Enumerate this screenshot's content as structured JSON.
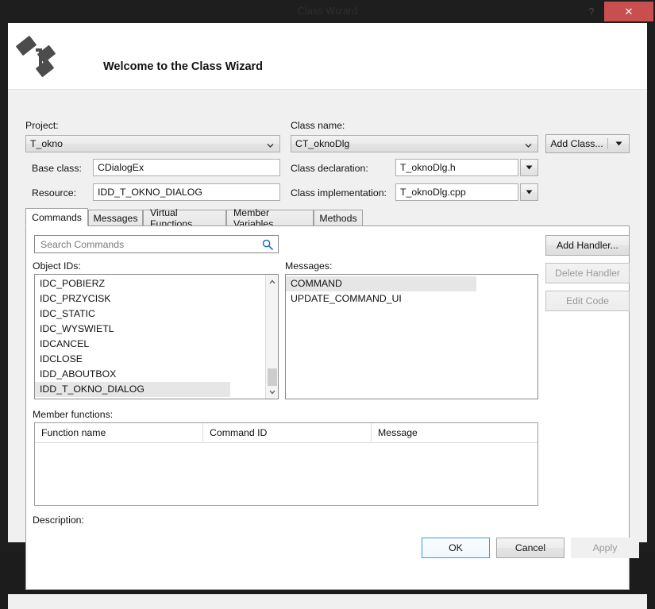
{
  "window": {
    "title": "Class Wizard",
    "help_icon": "question-mark-icon",
    "close_icon": "✕"
  },
  "header": {
    "heading": "Welcome to the Class Wizard",
    "logo_icon": "class-diagram-icon"
  },
  "form": {
    "project_label": "Project:",
    "project_value": "T_okno",
    "class_name_label": "Class name:",
    "class_name_value": "CT_oknoDlg",
    "base_class_label": "Base class:",
    "base_class_value": "CDialogEx",
    "class_declaration_label": "Class declaration:",
    "class_declaration_value": "T_oknoDlg.h",
    "resource_label": "Resource:",
    "resource_value": "IDD_T_OKNO_DIALOG",
    "class_implementation_label": "Class implementation:",
    "class_implementation_value": "T_oknoDlg.cpp",
    "add_class_label": "Add Class...",
    "add_class_dropdown_icon": "caret-down-icon"
  },
  "tabs": [
    {
      "label": "Commands",
      "active": true
    },
    {
      "label": "Messages",
      "active": false
    },
    {
      "label": "Virtual Functions",
      "active": false
    },
    {
      "label": "Member Variables",
      "active": false
    },
    {
      "label": "Methods",
      "active": false
    }
  ],
  "search": {
    "placeholder": "Search Commands",
    "value": "",
    "icon": "search-icon"
  },
  "object_ids": {
    "label": "Object IDs:",
    "items": [
      {
        "text": "IDC_POBIERZ",
        "selected": false
      },
      {
        "text": "IDC_PRZYCISK",
        "selected": false
      },
      {
        "text": "IDC_STATIC",
        "selected": false
      },
      {
        "text": "IDC_WYSWIETL",
        "selected": false
      },
      {
        "text": "IDCANCEL",
        "selected": false
      },
      {
        "text": "IDCLOSE",
        "selected": false
      },
      {
        "text": "IDD_ABOUTBOX",
        "selected": false
      },
      {
        "text": "IDD_T_OKNO_DIALOG",
        "selected": true
      }
    ]
  },
  "messages": {
    "label": "Messages:",
    "items": [
      {
        "text": "COMMAND",
        "selected": true
      },
      {
        "text": "UPDATE_COMMAND_UI",
        "selected": false
      }
    ]
  },
  "handler_buttons": [
    {
      "label": "Add Handler...",
      "enabled": true
    },
    {
      "label": "Delete Handler",
      "enabled": false
    },
    {
      "label": "Edit Code",
      "enabled": false
    }
  ],
  "member_functions": {
    "label": "Member functions:",
    "columns": [
      "Function name",
      "Command ID",
      "Message"
    ],
    "rows": []
  },
  "description": {
    "label": "Description:",
    "text": ""
  },
  "footer_buttons": [
    {
      "label": "OK",
      "enabled": true,
      "focused": true
    },
    {
      "label": "Cancel",
      "enabled": true,
      "focused": false
    },
    {
      "label": "Apply",
      "enabled": false,
      "focused": false
    }
  ],
  "colors": {
    "accent": "#3399e6",
    "close_button": "#c94f4f",
    "window_chrome": "#1e1e1e",
    "panel": "#f0f0f0",
    "selection": "#e6e6e6"
  }
}
